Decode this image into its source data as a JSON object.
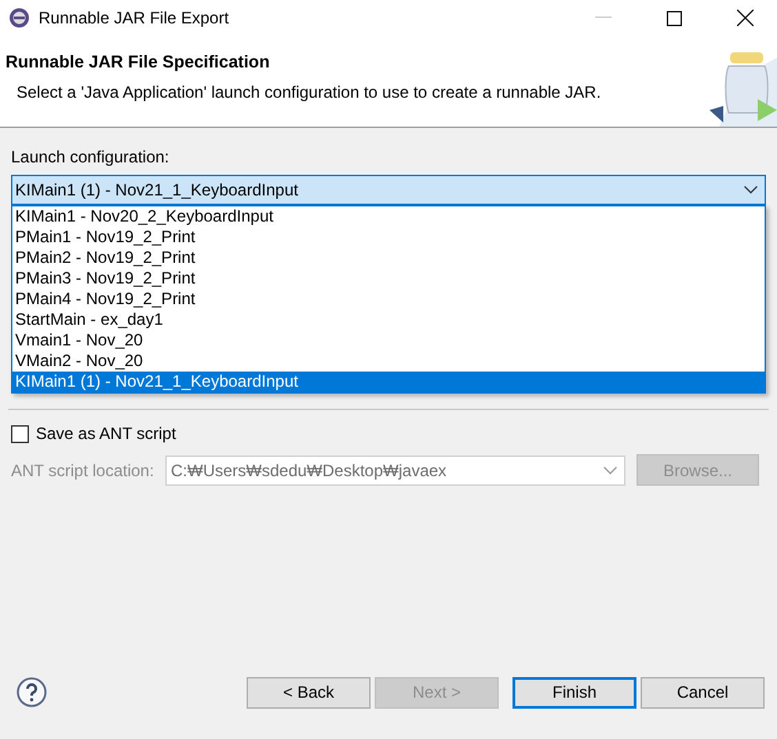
{
  "window": {
    "title": "Runnable JAR File Export"
  },
  "header": {
    "title": "Runnable JAR File Specification",
    "description": "Select a 'Java Application' launch configuration to use to create a runnable JAR."
  },
  "launch_configuration": {
    "label": "Launch configuration:",
    "value": "KIMain1 (1) - Nov21_1_KeyboardInput",
    "expanded": true,
    "options": [
      {
        "label": "KIMain1 - Nov20_2_KeyboardInput",
        "selected": false
      },
      {
        "label": "PMain1 - Nov19_2_Print",
        "selected": false
      },
      {
        "label": "PMain2 - Nov19_2_Print",
        "selected": false
      },
      {
        "label": "PMain3 - Nov19_2_Print",
        "selected": false
      },
      {
        "label": "PMain4 - Nov19_2_Print",
        "selected": false
      },
      {
        "label": "StartMain - ex_day1",
        "selected": false
      },
      {
        "label": "Vmain1 - Nov_20",
        "selected": false
      },
      {
        "label": "VMain2 - Nov_20",
        "selected": false
      },
      {
        "label": "KIMain1 (1) - Nov21_1_KeyboardInput",
        "selected": true
      }
    ]
  },
  "ant": {
    "label": "Save as ANT script",
    "checked": false,
    "location_label": "ANT script location:",
    "location": "C:₩Users₩sdedu₩Desktop₩javaex",
    "disabled": true,
    "browse": "Browse..."
  },
  "buttons": [
    {
      "label": "< Back",
      "disabled": false,
      "default": false
    },
    {
      "label": "Next >",
      "disabled": true,
      "default": false
    },
    {
      "label": "Finish",
      "disabled": false,
      "default": true
    },
    {
      "label": "Cancel",
      "disabled": false,
      "default": false
    }
  ]
}
